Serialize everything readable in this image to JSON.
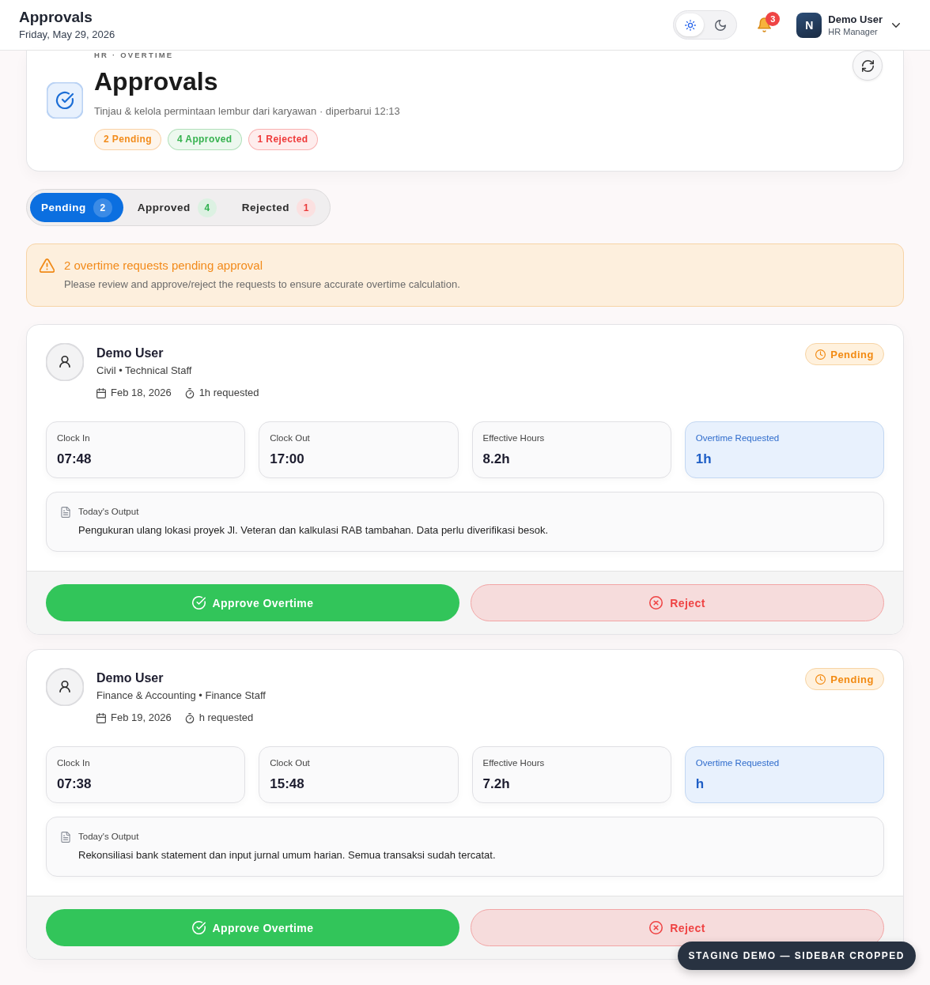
{
  "top_bar": {
    "title": "Approvals",
    "date": "Friday, May 29, 2026",
    "theme_toggle": [
      {
        "kind": "light",
        "selected": true
      },
      {
        "kind": "dark",
        "selected": false
      }
    ],
    "notification_count": "3",
    "user": {
      "initial": "N",
      "name": "Demo User",
      "role": "HR Manager"
    }
  },
  "header": {
    "eyebrow": "HR · OVERTIME",
    "title": "Approvals",
    "subtitle": "Tinjau & kelola permintaan lembur dari karyawan · diperbarui 12:13",
    "summary": [
      {
        "label": "2 Pending",
        "color": "#f28c1c"
      },
      {
        "label": "4 Approved",
        "color": "#36b24f"
      },
      {
        "label": "1 Rejected",
        "color": "#ef3a3a"
      }
    ]
  },
  "tabs": [
    {
      "label": "Pending",
      "count": "2",
      "kind": "pending",
      "selected": true
    },
    {
      "label": "Approved",
      "count": "4",
      "kind": "approved",
      "selected": false
    },
    {
      "label": "Rejected",
      "count": "1",
      "kind": "rejected",
      "selected": false
    }
  ],
  "alert": {
    "title": "2 overtime requests pending approval",
    "message": "Please review and approve/reject the requests to ensure accurate overtime calculation."
  },
  "requests": [
    {
      "name": "Demo User",
      "department": "Civil • Technical Staff",
      "date": "Feb 18, 2026",
      "requested": "1h requested",
      "status": {
        "label": "Pending",
        "kind": "pending"
      },
      "stats": [
        {
          "label": "Clock In",
          "value": "07:48",
          "highlighted": false
        },
        {
          "label": "Clock Out",
          "value": "17:00",
          "highlighted": false
        },
        {
          "label": "Effective Hours",
          "value": "8.2h",
          "highlighted": false
        },
        {
          "label": "Overtime Requested",
          "value": "1h",
          "highlighted": true
        }
      ],
      "output_label": "Today's Output",
      "output": "Pengukuran ulang lokasi proyek Jl. Veteran dan kalkulasi RAB tambahan. Data perlu diverifikasi besok.",
      "actions": [
        {
          "kind": "approve",
          "label": "Approve Overtime"
        },
        {
          "kind": "reject",
          "label": "Reject"
        }
      ]
    },
    {
      "name": "Demo User",
      "department": "Finance & Accounting • Finance Staff",
      "date": "Feb 19, 2026",
      "requested": "h requested",
      "status": {
        "label": "Pending",
        "kind": "pending"
      },
      "stats": [
        {
          "label": "Clock In",
          "value": "07:38",
          "highlighted": false
        },
        {
          "label": "Clock Out",
          "value": "15:48",
          "highlighted": false
        },
        {
          "label": "Effective Hours",
          "value": "7.2h",
          "highlighted": false
        },
        {
          "label": "Overtime Requested",
          "value": "h",
          "highlighted": true
        }
      ],
      "output_label": "Today's Output",
      "output": "Rekonsiliasi bank statement dan input jurnal umum harian. Semua transaksi sudah tercatat.",
      "actions": [
        {
          "kind": "approve",
          "label": "Approve Overtime"
        },
        {
          "kind": "reject",
          "label": "Reject"
        }
      ]
    }
  ],
  "environment_badge": "STAGING DEMO — SIDEBAR CROPPED"
}
